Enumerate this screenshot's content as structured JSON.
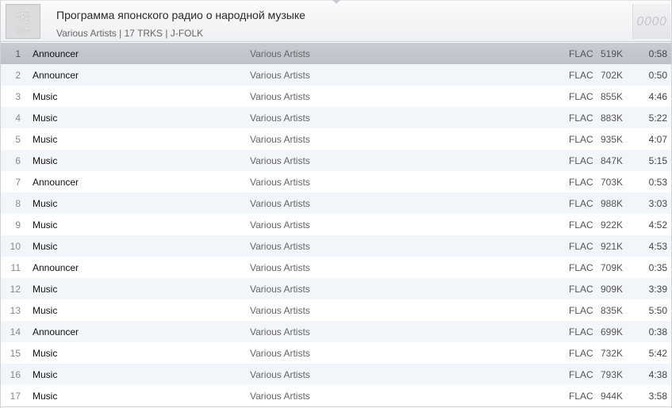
{
  "album": {
    "title": "Программа японского радио о народной музыке",
    "meta": "Various Artists | 17 TRKS | J-FOLK",
    "rating_text": "0000",
    "cover_icon": "album-cover-placeholder"
  },
  "tracks": [
    {
      "num": "1",
      "title": "Announcer",
      "artist": "Various Artists",
      "format": "FLAC",
      "bitrate": "519K",
      "duration": "0:58"
    },
    {
      "num": "2",
      "title": "Announcer",
      "artist": "Various Artists",
      "format": "FLAC",
      "bitrate": "702K",
      "duration": "0:50"
    },
    {
      "num": "3",
      "title": "Music",
      "artist": "Various Artists",
      "format": "FLAC",
      "bitrate": "855K",
      "duration": "4:46"
    },
    {
      "num": "4",
      "title": "Music",
      "artist": "Various Artists",
      "format": "FLAC",
      "bitrate": "883K",
      "duration": "5:22"
    },
    {
      "num": "5",
      "title": "Music",
      "artist": "Various Artists",
      "format": "FLAC",
      "bitrate": "935K",
      "duration": "4:07"
    },
    {
      "num": "6",
      "title": "Music",
      "artist": "Various Artists",
      "format": "FLAC",
      "bitrate": "847K",
      "duration": "5:15"
    },
    {
      "num": "7",
      "title": "Announcer",
      "artist": "Various Artists",
      "format": "FLAC",
      "bitrate": "703K",
      "duration": "0:53"
    },
    {
      "num": "8",
      "title": "Music",
      "artist": "Various Artists",
      "format": "FLAC",
      "bitrate": "988K",
      "duration": "3:03"
    },
    {
      "num": "9",
      "title": "Music",
      "artist": "Various Artists",
      "format": "FLAC",
      "bitrate": "922K",
      "duration": "4:52"
    },
    {
      "num": "10",
      "title": "Music",
      "artist": "Various Artists",
      "format": "FLAC",
      "bitrate": "921K",
      "duration": "4:53"
    },
    {
      "num": "11",
      "title": "Announcer",
      "artist": "Various Artists",
      "format": "FLAC",
      "bitrate": "709K",
      "duration": "0:35"
    },
    {
      "num": "12",
      "title": "Music",
      "artist": "Various Artists",
      "format": "FLAC",
      "bitrate": "909K",
      "duration": "3:39"
    },
    {
      "num": "13",
      "title": "Music",
      "artist": "Various Artists",
      "format": "FLAC",
      "bitrate": "835K",
      "duration": "5:50"
    },
    {
      "num": "14",
      "title": "Announcer",
      "artist": "Various Artists",
      "format": "FLAC",
      "bitrate": "699K",
      "duration": "0:38"
    },
    {
      "num": "15",
      "title": "Music",
      "artist": "Various Artists",
      "format": "FLAC",
      "bitrate": "732K",
      "duration": "5:42"
    },
    {
      "num": "16",
      "title": "Music",
      "artist": "Various Artists",
      "format": "FLAC",
      "bitrate": "793K",
      "duration": "4:38"
    },
    {
      "num": "17",
      "title": "Music",
      "artist": "Various Artists",
      "format": "FLAC",
      "bitrate": "944K",
      "duration": "3:58"
    }
  ],
  "selected_track": "1",
  "colors": {
    "selected_row": "#c2c6ce",
    "alt_row": "#f2f6fb",
    "header_bg": "#eef0f3"
  }
}
